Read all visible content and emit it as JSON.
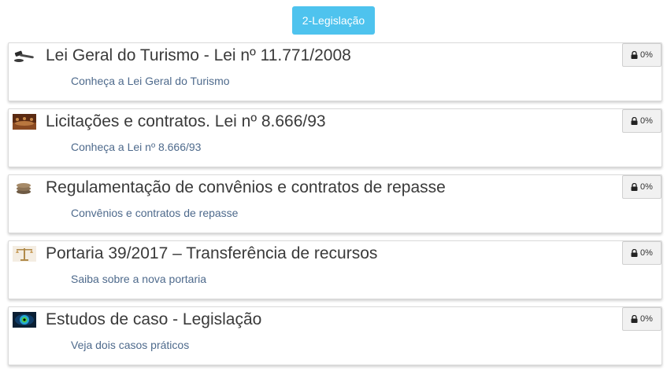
{
  "header": {
    "section_label": "2-Legislação"
  },
  "modules": [
    {
      "icon": "gavel-icon",
      "title": "Lei Geral do Turismo - Lei nº 11.771/2008",
      "subtitle": "Conheça a Lei Geral do Turismo",
      "progress": "0%"
    },
    {
      "icon": "meeting-room-icon",
      "title": "Licitações e contratos. Lei nº 8.666/93",
      "subtitle": "Conheça a Lei nº 8.666/93",
      "progress": "0%"
    },
    {
      "icon": "stacked-coins-icon",
      "title": "Regulamentação de convênios e contratos de repasse",
      "subtitle": "Convênios e contratos de repasse",
      "progress": "0%"
    },
    {
      "icon": "scales-icon",
      "title": "Portaria 39/2017 – Transferência de recursos",
      "subtitle": "Saiba sobre a nova portaria",
      "progress": "0%"
    },
    {
      "icon": "eye-icon",
      "title": "Estudos de caso - Legislação",
      "subtitle": "Veja dois casos práticos",
      "progress": "0%"
    }
  ]
}
